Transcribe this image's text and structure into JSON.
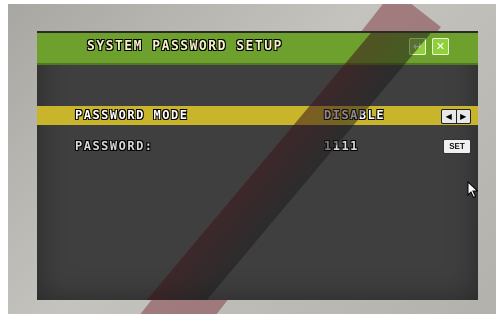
{
  "window": {
    "title": "SYSTEM PASSWORD SETUP",
    "return_icon": "return-icon",
    "close_icon": "close-icon",
    "return_glyph": "↵",
    "close_glyph": "✕"
  },
  "settings": {
    "password_mode": {
      "label": "PASSWORD MODE",
      "value": "DISABLE",
      "prev_glyph": "◀",
      "next_glyph": "▶"
    },
    "password": {
      "label": "PASSWORD:",
      "value": "1111",
      "button_label": "SET"
    }
  },
  "colors": {
    "titlebar": "#6da02c",
    "highlight": "#c9b52c",
    "screen": "#3f3f3f"
  }
}
